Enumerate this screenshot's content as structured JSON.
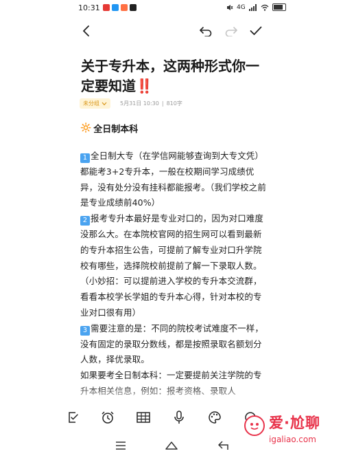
{
  "status_bar": {
    "time": "10:31",
    "network_label": "4G",
    "battery_level": 0.85
  },
  "toolbar": {
    "back_icon": "chevron-left-icon",
    "undo_icon": "undo-icon",
    "redo_icon": "redo-icon",
    "done_icon": "checkmark-icon"
  },
  "note": {
    "title": "关于专升本，这两种形式你一定要知道",
    "title_emoji": "‼️",
    "category": "未分组",
    "date": "5月31日 10:30",
    "separator": "|",
    "word_count": "810字",
    "section_emoji": "🔆",
    "section_heading": "全日制本科",
    "paragraph1_badge": "1",
    "paragraph1": "全日制大专（在学信网能够查询到大专文凭）都能考3+2专升本，一般在校期间学习成绩优异，没有处分没有挂科都能报考。（我们学校之前是专业成绩前40%）",
    "paragraph2_badge": "2",
    "paragraph2": "报考专升本最好是专业对口的，因为对口难度没那么大。在本院校官网的招生网可以看到最新的专升本招生公告，可提前了解专业对口升学院校有哪些，选择院校前提前了解一下录取人数。（小妙招：可以提前进入学校的专升本交流群，看看本校学长学姐的专升本心得，针对本校的专业对口很有用）",
    "paragraph3_badge": "3",
    "paragraph3": "需要注意的是：不同的院校考试难度不一样，没有固定的录取分数线，都是按照录取名额划分人数，择优录取。",
    "paragraph4": "如果要考全日制本科：一定要提前关注学院的专升本相关信息，例如：报考资格、录取人"
  },
  "edit_toolbar": {
    "icons": [
      "checkbox-icon",
      "alarm-clock-icon",
      "table-icon",
      "microphone-icon",
      "palette-icon",
      "more-icon"
    ]
  },
  "nav_bar": {
    "icons": [
      "menu-icon",
      "home-icon",
      "back-icon"
    ]
  },
  "watermark": {
    "text": "爱·尬聊",
    "url": "igaliao.com"
  },
  "colors": {
    "accent_blue": "#4aa3f0",
    "category_bg": "#fff4d6",
    "category_text": "#d9961a",
    "watermark_red": "#e8324a"
  }
}
